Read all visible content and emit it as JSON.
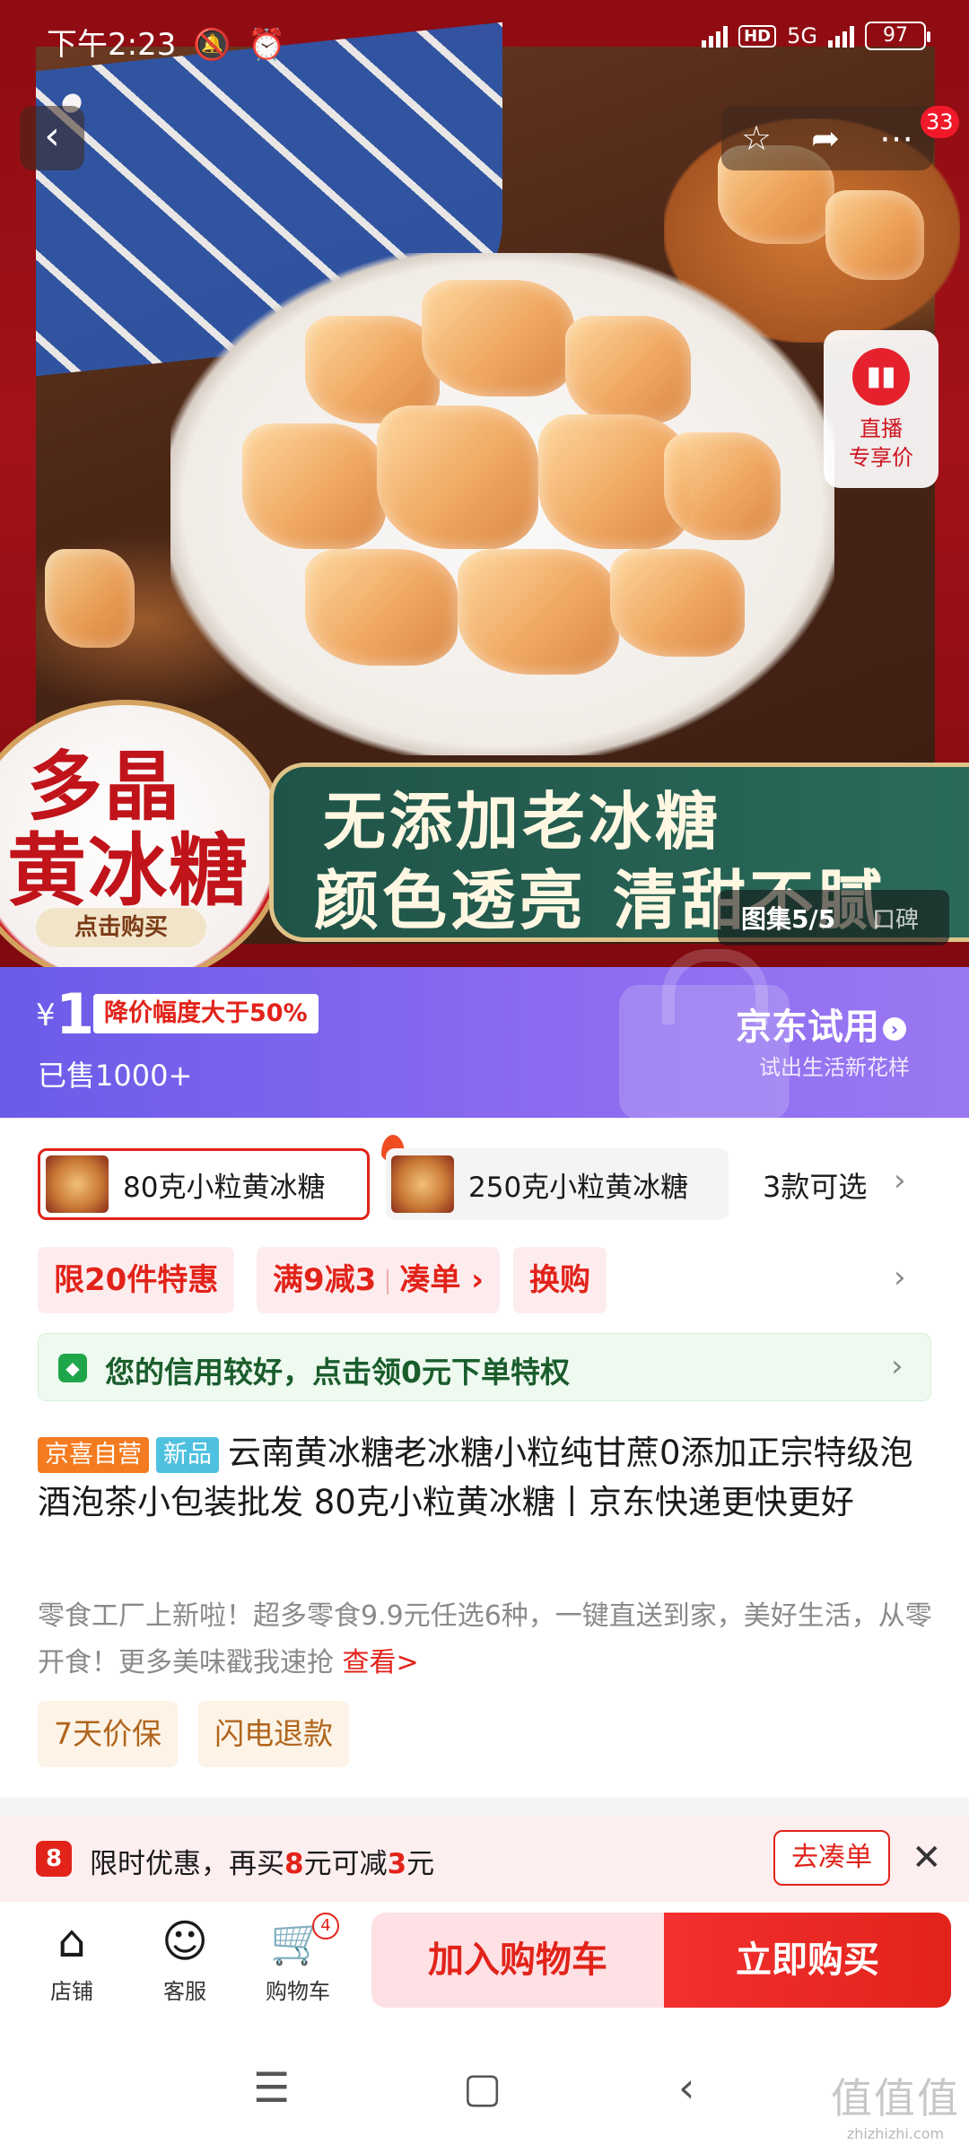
{
  "status_bar": {
    "time": "下午2:23",
    "network": "5G",
    "hd": "HD",
    "battery": "97"
  },
  "nav": {
    "notification_count": "33"
  },
  "hero": {
    "badge_line1": "多晶",
    "badge_line2": "黄冰糖",
    "badge_button": "点击购买",
    "banner_line1": "无添加老冰糖",
    "banner_line2": "颜色透亮 清甜不腻",
    "live_label1": "直播",
    "live_label2": "专享价",
    "gallery": "图集5/5",
    "review": "口碑"
  },
  "price": {
    "currency": "¥",
    "amount": "1",
    "drop_tag": "降价幅度大于50%",
    "sold": "已售1000+",
    "trial_title": "京东试用",
    "trial_sub": "试出生活新花样"
  },
  "sku": {
    "options": [
      "80克小粒黄冰糖",
      "250克小粒黄冰糖"
    ],
    "more": "3款可选"
  },
  "promos": {
    "tag1": "限20件特惠",
    "tag2_a": "满9减3",
    "tag2_b": "凑单 ›",
    "tag3": "换购"
  },
  "credit": {
    "text": "您的信用较好，点击领0元下单特权"
  },
  "product": {
    "tag_self": "京喜自营",
    "tag_new": "新品",
    "title": "云南黄冰糖老冰糖小粒纯甘蔗0添加正宗特级泡酒泡茶小包装批发 80克小粒黄冰糖丨京东快递更快更好",
    "desc": "零食工厂上新啦！超多零食9.9元任选6种，一键直送到家，美好生活，从零开食！更多美味戳我速抢",
    "desc_link": "查看>",
    "services": [
      "7天价保",
      "闪电退款"
    ]
  },
  "offer": {
    "text_a": "限时优惠，再买",
    "amount1": "8",
    "text_b": "元可减",
    "amount2": "3",
    "text_c": "元",
    "button": "去凑单"
  },
  "bottom_bar": {
    "shop": "店铺",
    "service": "客服",
    "cart": "购物车",
    "cart_count": "4",
    "add_to_cart": "加入购物车",
    "buy_now": "立即购买"
  },
  "watermark": {
    "logo": "值值值",
    "url": "zhizhizhi.com"
  }
}
